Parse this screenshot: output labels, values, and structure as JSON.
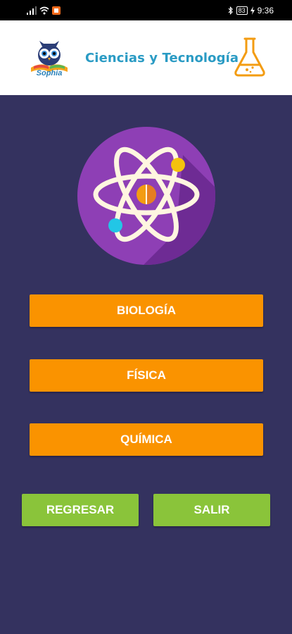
{
  "status_bar": {
    "time": "9:36",
    "battery": "83"
  },
  "header": {
    "title": "Ciencias y Tecnología",
    "logo_text": "Sophia"
  },
  "menu": {
    "biologia": "BIOLOGÍA",
    "fisica": "FÍSICA",
    "quimica": "QUÍMICA"
  },
  "actions": {
    "regresar": "REGRESAR",
    "salir": "SALIR"
  },
  "colors": {
    "background": "#34325f",
    "orange_button": "#fa9300",
    "green_button": "#8ac43a",
    "title": "#2a9bc4",
    "atom_circle": "#8e3fb5"
  }
}
